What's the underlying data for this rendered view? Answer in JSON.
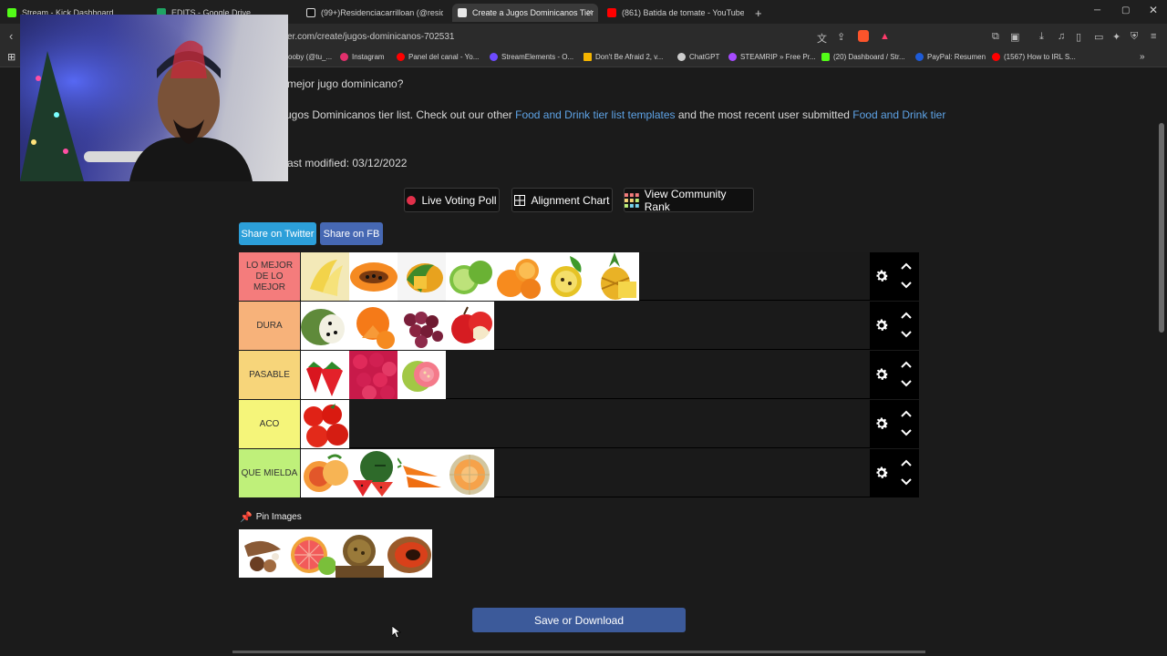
{
  "browser": {
    "tabs": [
      {
        "title": "Stream - Kick Dashboard",
        "color": "#53fc18"
      },
      {
        "title": "EDITS - Google Drive",
        "color": "#1fa463"
      },
      {
        "title": "(99+)Residenciacarrilloan (@residenc",
        "color": "#ffffff"
      },
      {
        "title": "Create a Jugos Dominicanos Tier",
        "color": "#e9e9e9",
        "active": true
      },
      {
        "title": "(861) Batida de tomate - YouTube",
        "color": "#ff0000"
      }
    ],
    "new_tab": "+",
    "url": "ker.com/create/jugos-dominicanos-702531",
    "bookmarks": [
      {
        "label": "ooby (@tu_...",
        "color": "#888888"
      },
      {
        "label": "Instagram",
        "color": "#e1306c"
      },
      {
        "label": "Panel del canal - Yo...",
        "color": "#ff0000"
      },
      {
        "label": "StreamElements - O...",
        "color": "#6e4bff"
      },
      {
        "label": "Don't Be Afraid 2, v...",
        "color": "#f4b400"
      },
      {
        "label": "ChatGPT",
        "color": "#cccccc"
      },
      {
        "label": "STEAMRIP » Free Pr...",
        "color": "#a64bff"
      },
      {
        "label": "(20) Dashboard / Str...",
        "color": "#53fc18"
      },
      {
        "label": "PayPal: Resumen",
        "color": "#1e5bd7"
      },
      {
        "label": "(1567) How to IRL S...",
        "color": "#ff0000"
      }
    ]
  },
  "intro": {
    "question": "mejor jugo dominicano?",
    "line_prefix": "ugos Dominicanos tier list. Check out our other ",
    "link1": "Food and Drink tier list templates",
    "line_middle": " and the most recent user submitted ",
    "link2": "Food and Drink tier",
    "last_modified": "ast modified: 03/12/2022"
  },
  "actions": {
    "live_voting": "Live Voting Poll",
    "alignment_chart": "Alignment Chart",
    "community_rank": "View Community Rank",
    "share_twitter": "Share on Twitter",
    "share_fb": "Share on FB"
  },
  "tiers": [
    {
      "label": "LO MEJOR DE LO MEJOR",
      "color": "#f47c7c",
      "items": [
        "banana",
        "papaya",
        "mango",
        "lime",
        "orange",
        "passion-fruit",
        "pineapple"
      ]
    },
    {
      "label": "DURA",
      "color": "#f7b27a",
      "items": [
        "soursop",
        "tangerine",
        "grape",
        "apple"
      ]
    },
    {
      "label": "PASABLE",
      "color": "#f7d57a",
      "items": [
        "strawberry",
        "raspberry",
        "guava"
      ]
    },
    {
      "label": "ACO",
      "color": "#f5f57a",
      "items": [
        "tomato"
      ]
    },
    {
      "label": "QUE MIELDA",
      "color": "#bff07a",
      "items": [
        "peach",
        "watermelon",
        "carrot",
        "cantaloupe"
      ]
    }
  ],
  "pin_images": "Pin Images",
  "pinned": [
    "tamarind",
    "grapefruit",
    "chinola",
    "zapote"
  ],
  "save": "Save or Download"
}
